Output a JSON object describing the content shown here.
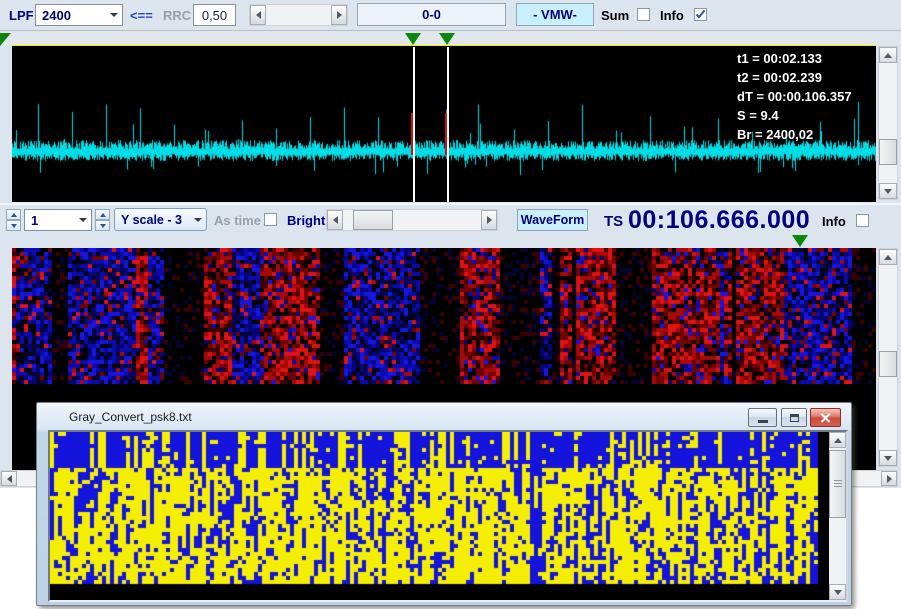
{
  "toolbar1": {
    "lpf_label": "LPF",
    "lpf_value": "2400",
    "assign_arrow": "<==",
    "rrc_label": "RRC",
    "rrc_value": "0,50",
    "range_display": "0-0",
    "vmw_button_label": "- VMW-",
    "sum_label": "Sum",
    "sum_checked": false,
    "info_label": "Info",
    "info_checked": true
  },
  "waveform_panel": {
    "overlay_lines": [
      "t1 = 00:02.133",
      "t2 = 00:02.239",
      "dT = 00:00.106.357",
      "S = 9.4",
      "Br = 2400,02"
    ]
  },
  "toolbar2": {
    "channel_value": "1",
    "yscale_value": "Y scale - 3",
    "as_time_label": "As time",
    "as_time_checked": false,
    "bright_label": "Bright",
    "waveform_button_label": "WaveForm",
    "ts_label": "TS",
    "ts_value": "00:106.666.000",
    "info_label": "Info",
    "info_checked": false
  },
  "child_window": {
    "title": "Gray_Convert_psk8.txt"
  },
  "colors": {
    "navy": "#00007d",
    "waveform_cyan": "#00dde6",
    "marker_green": "#0c870c",
    "yellow_line": "#f0f000",
    "cursor_red": "#cf1010",
    "cursor_white": "#ffffff",
    "raster_reds": [
      "#e11212",
      "#a80909",
      "#6e0404"
    ],
    "raster_blues": [
      "#1616e4",
      "#0b0bb0",
      "#050573"
    ],
    "raster_dark_red": "#3a0202",
    "raster_dark_blue": "#050530",
    "bitmap_yellow": "#f4ef00",
    "bitmap_blue": "#1414dc",
    "button_cyan": "#c9f0fa"
  }
}
